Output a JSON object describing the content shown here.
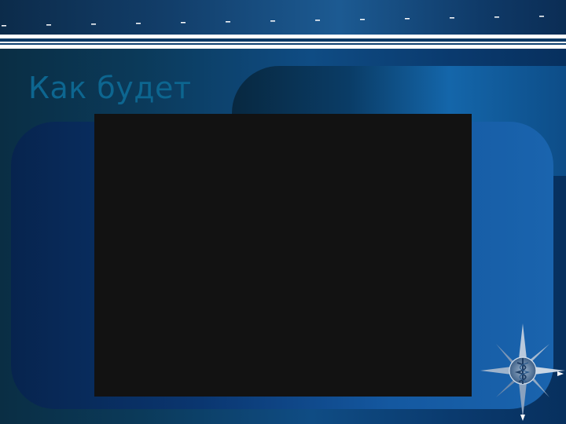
{
  "slide": {
    "title": "Как будет"
  },
  "media": {
    "video_frame_color": "#121212"
  },
  "emblem": {
    "icon": "compass-star-caduceus-icon"
  },
  "colors": {
    "title_text": "#0d6690",
    "background_blue": "#0f4c84",
    "panel_blue": "#1458a0"
  }
}
